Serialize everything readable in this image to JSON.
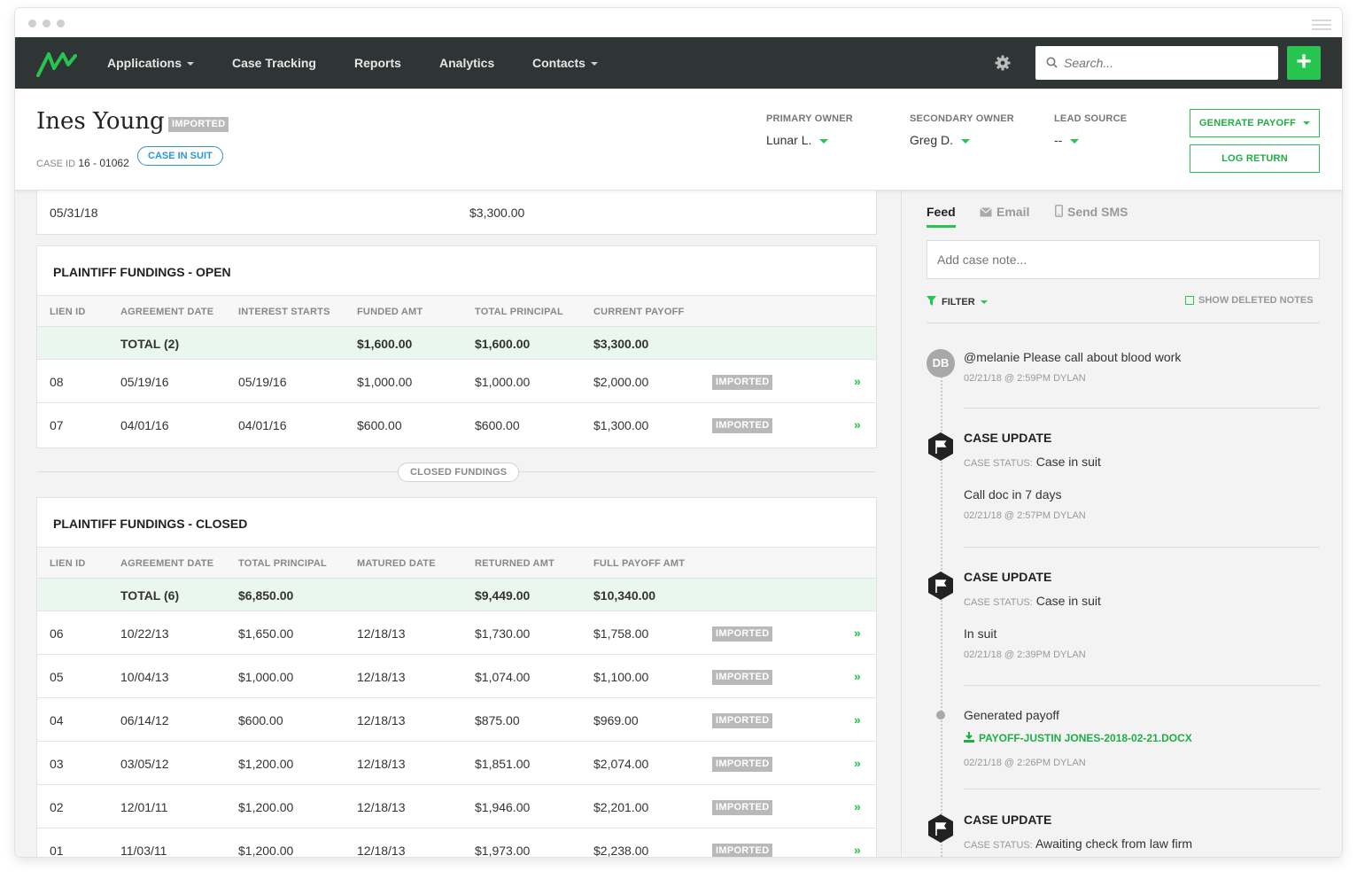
{
  "nav": {
    "items": [
      {
        "label": "Applications",
        "caret": true
      },
      {
        "label": "Case Tracking",
        "caret": false
      },
      {
        "label": "Reports",
        "caret": false
      },
      {
        "label": "Analytics",
        "caret": false
      },
      {
        "label": "Contacts",
        "caret": true
      }
    ],
    "search_placeholder": "Search...",
    "add_label": "+",
    "accent": "#27c44f"
  },
  "header": {
    "name": "Ines Young",
    "badge": "IMPORTED",
    "case_id_label": "CASE ID",
    "case_id": "16 - 01062",
    "status_pill": "CASE IN SUIT",
    "primary_owner_label": "PRIMARY OWNER",
    "primary_owner": "Lunar L.",
    "secondary_owner_label": "SECONDARY OWNER",
    "secondary_owner": "Greg D.",
    "lead_source_label": "LEAD SOURCE",
    "lead_source": "--",
    "generate_payoff": "GENERATE PAYOFF",
    "log_return": "LOG RETURN"
  },
  "top_row": {
    "date": "05/31/18",
    "amount": "$3,300.00"
  },
  "open": {
    "title": "PLAINTIFF FUNDINGS - OPEN",
    "headers": [
      "LIEN ID",
      "AGREEMENT DATE",
      "INTEREST STARTS",
      "FUNDED AMT",
      "TOTAL PRINCIPAL",
      "CURRENT PAYOFF"
    ],
    "total": {
      "label": "TOTAL (2)",
      "funded": "$1,600.00",
      "principal": "$1,600.00",
      "payoff": "$3,300.00"
    },
    "rows": [
      {
        "id": "08",
        "agreement": "05/19/16",
        "interest": "05/19/16",
        "funded": "$1,000.00",
        "principal": "$1,000.00",
        "payoff": "$2,000.00",
        "badge": "IMPORTED"
      },
      {
        "id": "07",
        "agreement": "04/01/16",
        "interest": "04/01/16",
        "funded": "$600.00",
        "principal": "$600.00",
        "payoff": "$1,300.00",
        "badge": "IMPORTED"
      }
    ]
  },
  "closed_label": "CLOSED FUNDINGS",
  "closed": {
    "title": "PLAINTIFF FUNDINGS - CLOSED",
    "headers": [
      "LIEN ID",
      "AGREEMENT DATE",
      "TOTAL PRINCIPAL",
      "MATURED DATE",
      "RETURNED AMT",
      "FULL PAYOFF AMT"
    ],
    "total": {
      "label": "TOTAL (6)",
      "principal": "$6,850.00",
      "returned": "$9,449.00",
      "payoff": "$10,340.00"
    },
    "rows": [
      {
        "id": "06",
        "agreement": "10/22/13",
        "principal": "$1,650.00",
        "matured": "12/18/13",
        "returned": "$1,730.00",
        "payoff": "$1,758.00",
        "badge": "IMPORTED"
      },
      {
        "id": "05",
        "agreement": "10/04/13",
        "principal": "$1,000.00",
        "matured": "12/18/13",
        "returned": "$1,074.00",
        "payoff": "$1,100.00",
        "badge": "IMPORTED"
      },
      {
        "id": "04",
        "agreement": "06/14/12",
        "principal": "$600.00",
        "matured": "12/18/13",
        "returned": "$875.00",
        "payoff": "$969.00",
        "badge": "IMPORTED"
      },
      {
        "id": "03",
        "agreement": "03/05/12",
        "principal": "$1,200.00",
        "matured": "12/18/13",
        "returned": "$1,851.00",
        "payoff": "$2,074.00",
        "badge": "IMPORTED"
      },
      {
        "id": "02",
        "agreement": "12/01/11",
        "principal": "$1,200.00",
        "matured": "12/18/13",
        "returned": "$1,946.00",
        "payoff": "$2,201.00",
        "badge": "IMPORTED"
      },
      {
        "id": "01",
        "agreement": "11/03/11",
        "principal": "$1,200.00",
        "matured": "12/18/13",
        "returned": "$1,973.00",
        "payoff": "$2,238.00",
        "badge": "IMPORTED"
      }
    ]
  },
  "feed": {
    "tabs": [
      "Feed",
      "Email",
      "Send SMS"
    ],
    "note_placeholder": "Add case note...",
    "filter": "FILTER",
    "show_deleted": "SHOW DELETED NOTES",
    "avatar_initials": "DB",
    "items": [
      {
        "text": "@melanie Please call about blood work",
        "meta": "02/21/18 @ 2:59PM DYLAN"
      },
      {
        "title": "CASE UPDATE",
        "status_label": "CASE STATUS:",
        "status": "Case in suit",
        "text": "Call doc in 7 days",
        "meta": "02/21/18 @ 2:57PM DYLAN"
      },
      {
        "title": "CASE UPDATE",
        "status_label": "CASE STATUS:",
        "status": "Case in suit",
        "text": "In suit",
        "meta": "02/21/18 @ 2:39PM DYLAN"
      },
      {
        "text": "Generated payoff",
        "link": "PAYOFF-JUSTIN JONES-2018-02-21.DOCX",
        "meta": "02/21/18 @ 2:26PM DYLAN"
      },
      {
        "title": "CASE UPDATE",
        "status_label": "CASE STATUS:",
        "status": "Awaiting check from law firm"
      }
    ]
  }
}
